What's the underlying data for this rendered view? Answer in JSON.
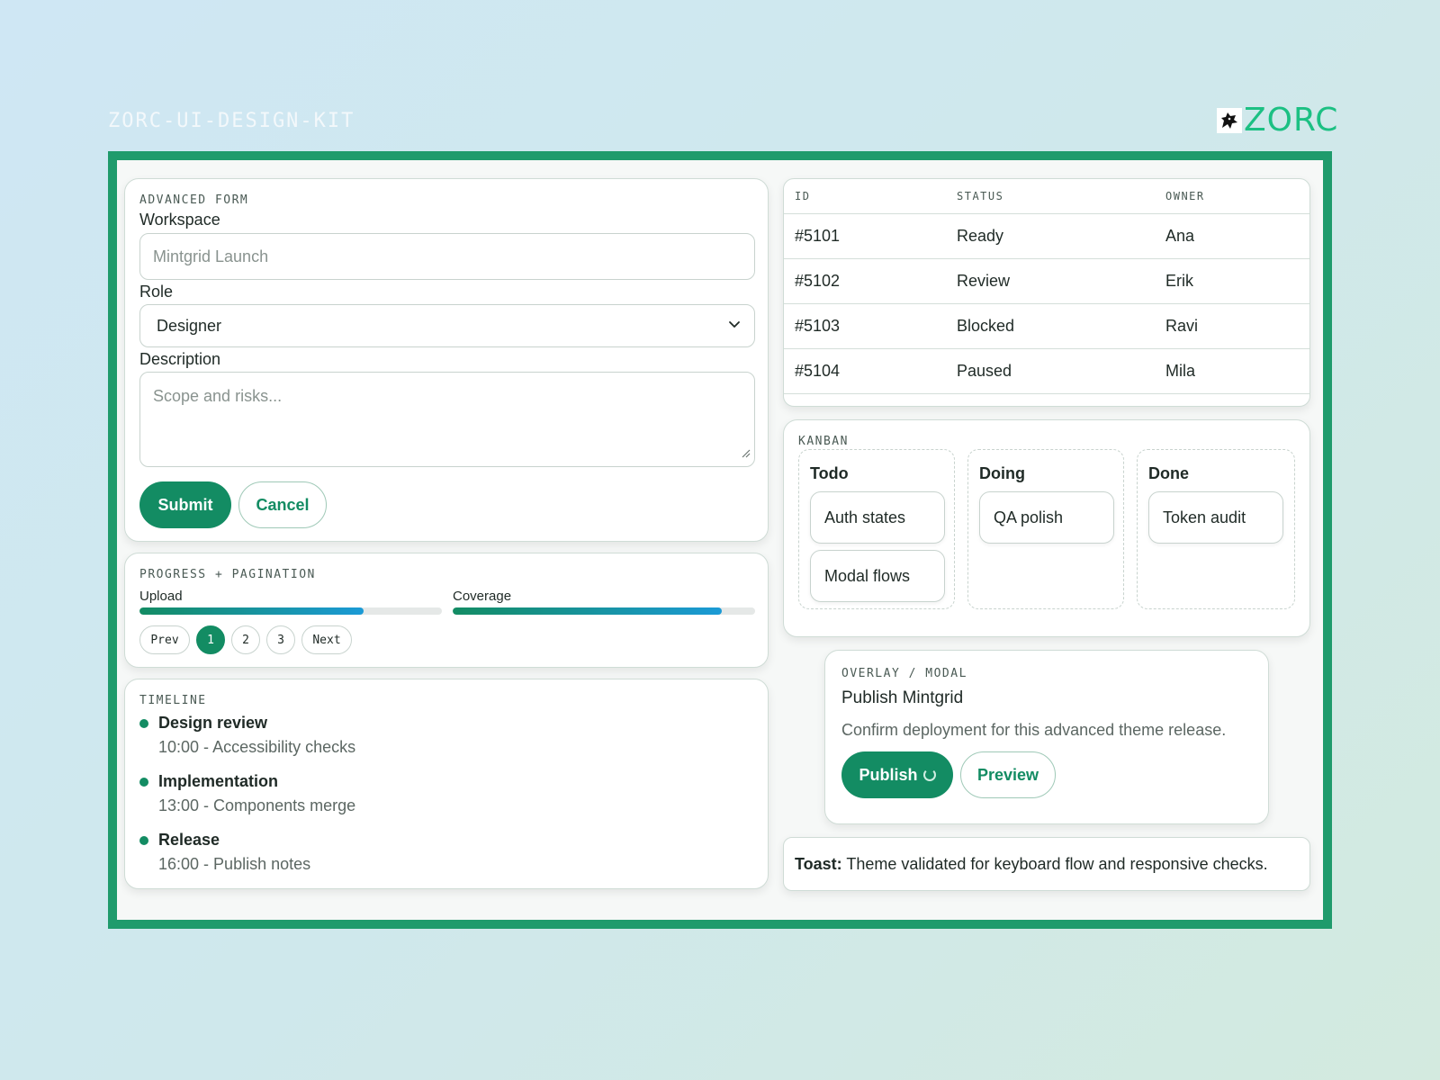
{
  "kit_label": "ZORC-UI-DESIGN-KIT",
  "logo_text": "ZORC",
  "colors": {
    "accent": "#138c63",
    "frame": "#1f9b6c",
    "logo": "#1cc083",
    "progress_end": "#1b9ad6"
  },
  "form": {
    "eyebrow": "ADVANCED FORM",
    "workspace_label": "Workspace",
    "workspace_placeholder": "Mintgrid Launch",
    "role_label": "Role",
    "role_value": "Designer",
    "description_label": "Description",
    "description_placeholder": "Scope and risks...",
    "submit_label": "Submit",
    "cancel_label": "Cancel"
  },
  "progress": {
    "eyebrow": "PROGRESS + PAGINATION",
    "bars": [
      {
        "label": "Upload",
        "value": 0.74
      },
      {
        "label": "Coverage",
        "value": 0.89
      }
    ],
    "pagination": {
      "prev": "Prev",
      "pages": [
        "1",
        "2",
        "3"
      ],
      "active_page": "1",
      "next": "Next"
    }
  },
  "timeline": {
    "eyebrow": "TIMELINE",
    "items": [
      {
        "title": "Design review",
        "time": "10:00",
        "detail": "Accessibility checks"
      },
      {
        "title": "Implementation",
        "time": "13:00",
        "detail": "Components merge"
      },
      {
        "title": "Release",
        "time": "16:00",
        "detail": "Publish notes"
      }
    ]
  },
  "table": {
    "headers": [
      "ID",
      "STATUS",
      "OWNER"
    ],
    "rows": [
      [
        "#5101",
        "Ready",
        "Ana"
      ],
      [
        "#5102",
        "Review",
        "Erik"
      ],
      [
        "#5103",
        "Blocked",
        "Ravi"
      ],
      [
        "#5104",
        "Paused",
        "Mila"
      ]
    ]
  },
  "kanban": {
    "eyebrow": "KANBAN",
    "columns": [
      {
        "title": "Todo",
        "cards": [
          "Auth states",
          "Modal flows"
        ]
      },
      {
        "title": "Doing",
        "cards": [
          "QA polish"
        ]
      },
      {
        "title": "Done",
        "cards": [
          "Token audit"
        ]
      }
    ]
  },
  "modal": {
    "eyebrow": "OVERLAY / MODAL",
    "title": "Publish Mintgrid",
    "body": "Confirm deployment for this advanced theme release.",
    "publish_label": "Publish",
    "preview_label": "Preview"
  },
  "toast": {
    "label": "Toast:",
    "message": "Theme validated for keyboard flow and responsive checks."
  }
}
